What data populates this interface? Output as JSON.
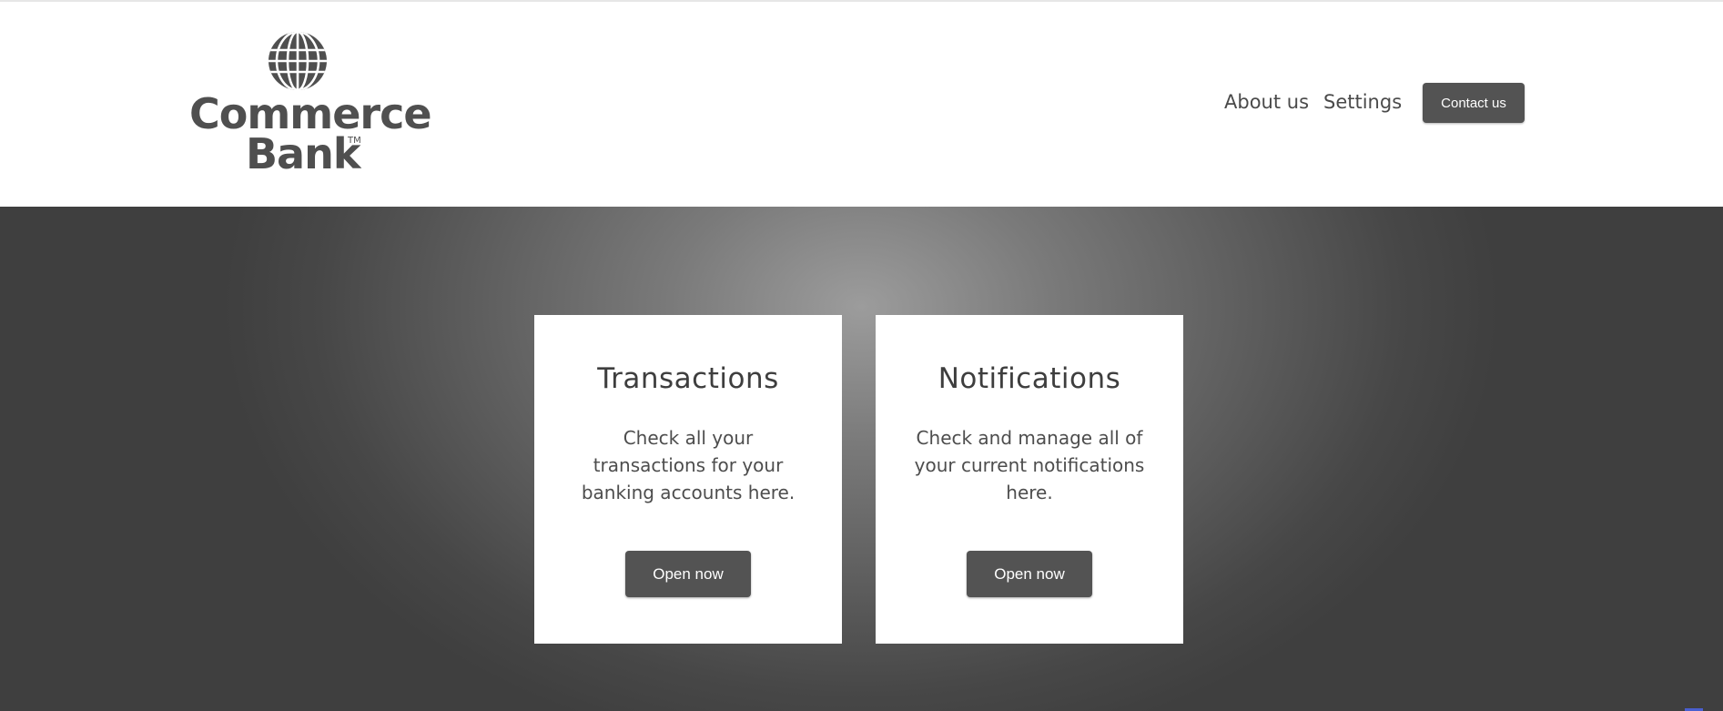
{
  "brand": {
    "line1": "Commerce",
    "line2": "Bank",
    "trademark": "TM",
    "icon": "globe-icon"
  },
  "nav": {
    "about_label": "About us",
    "settings_label": "Settings",
    "contact_label": "Contact us"
  },
  "cards": [
    {
      "title": "Transactions",
      "description": "Check all your transactions for your banking accounts here.",
      "button_label": "Open now"
    },
    {
      "title": "Notifications",
      "description": "Check and manage all of your current notifications here.",
      "button_label": "Open now"
    }
  ],
  "colors": {
    "button": "#535353",
    "text": "#4a4a4a",
    "hero_center": "#9c9c9c",
    "hero_edge": "#3f3f3f"
  }
}
